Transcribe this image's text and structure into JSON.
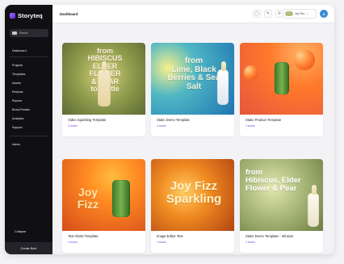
{
  "sidebar": {
    "brand": "Storyteq",
    "search_placeholder": "Search",
    "items": [
      {
        "label": "Dashboard"
      },
      {
        "label": "Projects"
      },
      {
        "label": "Templates"
      },
      {
        "label": "Assets"
      },
      {
        "label": "Reviews"
      },
      {
        "label": "Planner"
      },
      {
        "label": "Brand Portals"
      },
      {
        "label": "Analytics"
      },
      {
        "label": "Support"
      },
      {
        "label": "Admin"
      }
    ],
    "collapse_label": "Collapse",
    "footer_label": "Create Brief"
  },
  "header": {
    "title": "Dashboard",
    "brand_selector": {
      "value": "Joy Fizz"
    },
    "avatar_initial": "S"
  },
  "cards": [
    {
      "title": "Video Sparkling Template",
      "subtitle": "3 assets",
      "thumb_text": "from\nHIBISCUS\nELDER\nFLOWER\n& PEAR\nto bottle"
    },
    {
      "title": "Static Demo Template",
      "subtitle": "2 assets",
      "thumb_text": "from\nLime, Black\nBerries & Sea\nSalt"
    },
    {
      "title": "Static Product Template",
      "subtitle": "2 assets",
      "thumb_text": ""
    },
    {
      "title": "Test Shots Template",
      "subtitle": "3 assets",
      "thumb_text": "Joy\nFizz"
    },
    {
      "title": "Image Editor Test",
      "subtitle": "3 assets",
      "thumb_text": "Joy Fizz\nSparkling"
    },
    {
      "title": "Static Demo Template - Infusion",
      "subtitle": "2 assets",
      "thumb_text": "from\nHibiscus, Elder\nFlower & Pear"
    }
  ],
  "colors": {
    "sidebar_bg": "#101014",
    "accent_purple": "#8a54d8",
    "avatar_blue": "#3a8bd7"
  }
}
